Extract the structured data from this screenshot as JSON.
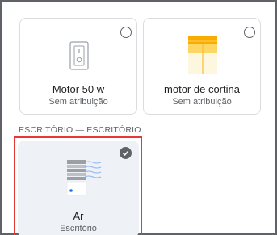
{
  "devices": [
    {
      "name": "Motor 50 w",
      "room": "Sem atribuição",
      "icon": "wall-switch-icon",
      "selected": false
    },
    {
      "name": "motor de cortina",
      "room": "Sem atribuição",
      "icon": "curtain-icon",
      "selected": false
    }
  ],
  "section": {
    "title": "ESCRITÓRIO — ESCRITÓRIO"
  },
  "room_devices": [
    {
      "name": "Ar",
      "room": "Escritório",
      "icon": "air-conditioner-icon",
      "selected": true
    }
  ],
  "colors": {
    "selection_highlight": "#e53935",
    "curtain_yellow": "#fdd663",
    "ac_blue": "#1a73e8"
  }
}
